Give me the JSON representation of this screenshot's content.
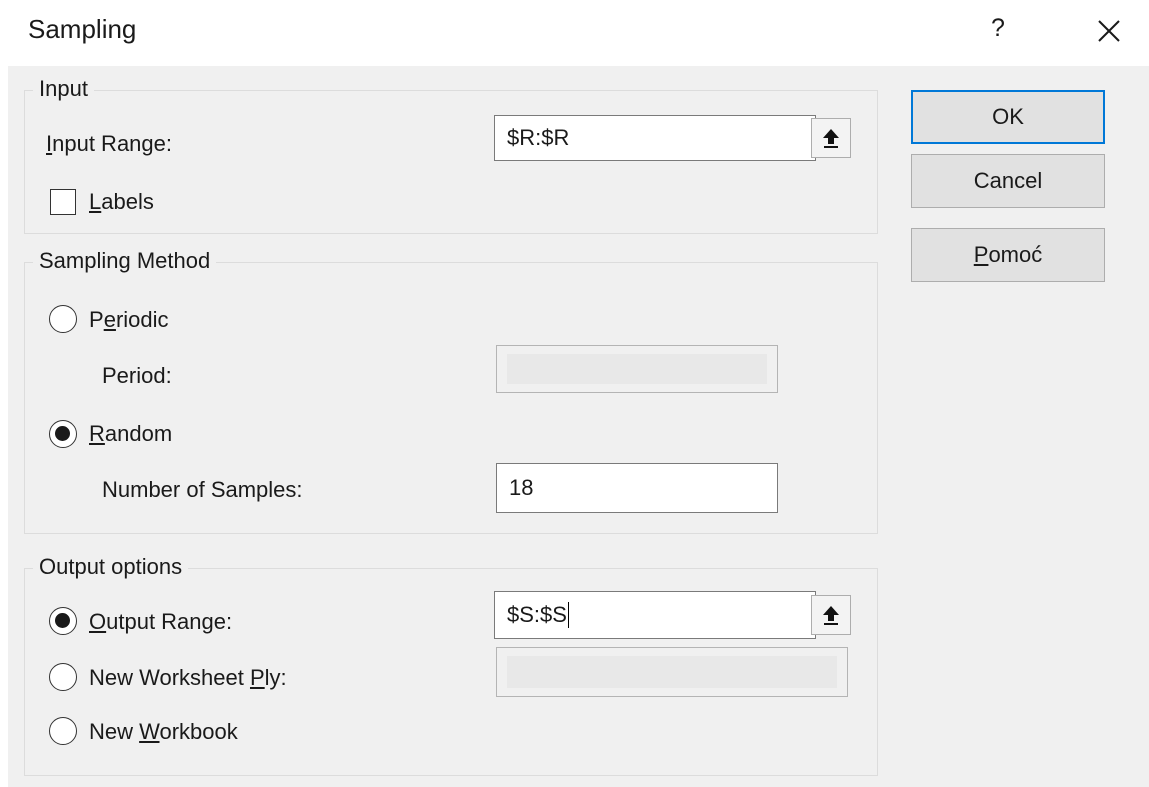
{
  "dialog": {
    "title": "Sampling",
    "help_label": "?",
    "close_icon": "close-icon"
  },
  "input": {
    "legend": "Input",
    "range_label": {
      "pre": "",
      "key": "I",
      "post": "nput Range:"
    },
    "range_value": "$R:$R",
    "labels_label": {
      "pre": "",
      "key": "L",
      "post": "abels"
    },
    "labels_checked": false
  },
  "sampling_method": {
    "legend": "Sampling Method",
    "periodic_label": {
      "pre": "P",
      "key": "e",
      "post": "riodic"
    },
    "period_label": "Period:",
    "period_value": "",
    "random_label": {
      "pre": "",
      "key": "R",
      "post": "andom"
    },
    "samples_label": "Number of Samples:",
    "samples_value": "18",
    "selected": "random"
  },
  "output": {
    "legend": "Output options",
    "output_range_label": {
      "pre": "",
      "key": "O",
      "post": "utput Range:"
    },
    "output_range_value": "$S:$S",
    "new_worksheet_label": {
      "pre": "New Worksheet ",
      "key": "P",
      "post": "ly:"
    },
    "new_worksheet_value": "",
    "new_workbook_label": {
      "pre": "New ",
      "key": "W",
      "post": "orkbook"
    },
    "selected": "output_range"
  },
  "buttons": {
    "ok": "OK",
    "cancel": "Cancel",
    "help": {
      "pre": "",
      "key": "P",
      "post": "omoć"
    }
  }
}
